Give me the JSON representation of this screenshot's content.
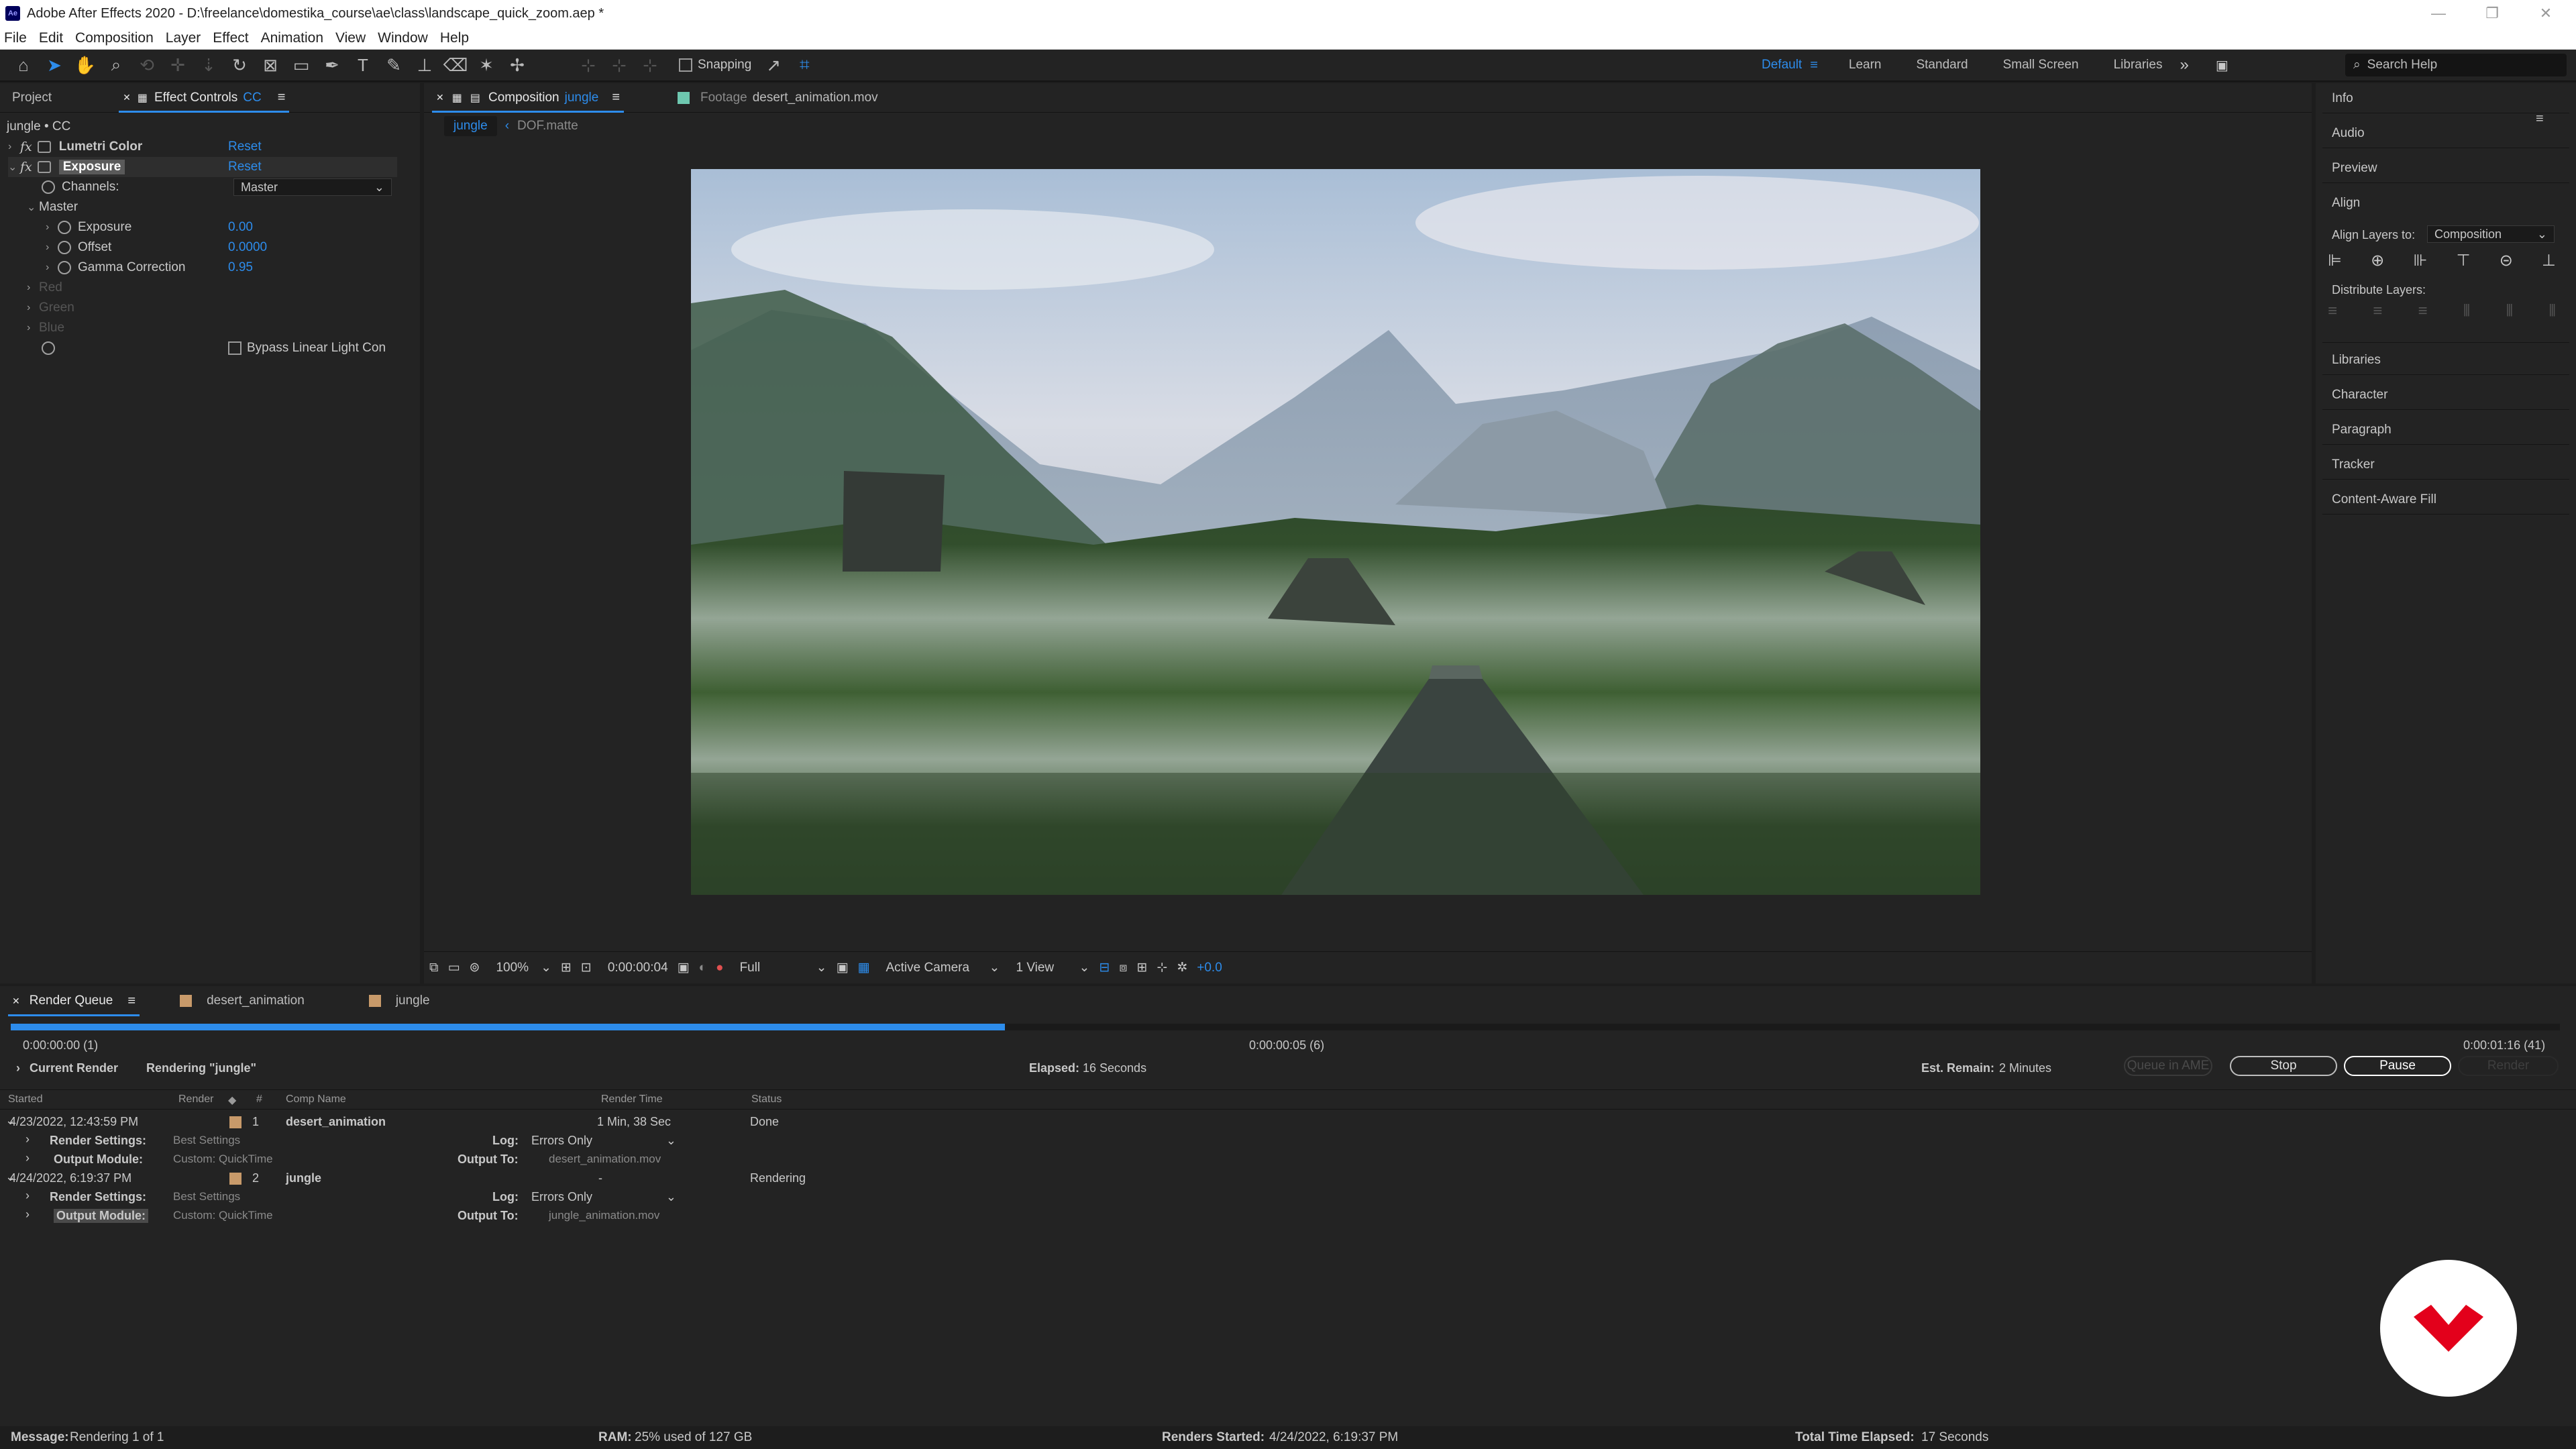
{
  "window": {
    "title": "Adobe After Effects 2020 - D:\\freelance\\domestika_course\\ae\\class\\landscape_quick_zoom.aep *",
    "logo": "Ae"
  },
  "menu": [
    "File",
    "Edit",
    "Composition",
    "Layer",
    "Effect",
    "Animation",
    "View",
    "Window",
    "Help"
  ],
  "toolbar": {
    "snapping_label": "Snapping",
    "workspaces": [
      "Default",
      "Learn",
      "Standard",
      "Small Screen",
      "Libraries"
    ],
    "active_workspace": "Default",
    "search_placeholder": "Search Help"
  },
  "effect_controls": {
    "tabs": [
      "Project",
      "Effect Controls",
      "CC"
    ],
    "layer_title": "jungle • CC",
    "effects": [
      {
        "name": "Lumetri Color",
        "reset": "Reset"
      },
      {
        "name": "Exposure",
        "reset": "Reset"
      }
    ],
    "channels_label": "Channels:",
    "channels_value": "Master",
    "master_label": "Master",
    "params": [
      {
        "name": "Exposure",
        "value": "0.00"
      },
      {
        "name": "Offset",
        "value": "0.0000"
      },
      {
        "name": "Gamma Correction",
        "value": "0.95"
      }
    ],
    "disabled_channels": [
      "Red",
      "Green",
      "Blue"
    ],
    "bypass_label": "Bypass Linear Light Con"
  },
  "composition": {
    "tab_label": "Composition",
    "tab_comp": "jungle",
    "footage_tab": "Footage",
    "footage_name": "desert_animation.mov",
    "breadcrumb": [
      "jungle",
      "DOF.matte"
    ],
    "zoom": "100%",
    "timecode": "0:00:00:04",
    "resolution": "Full",
    "camera": "Active Camera",
    "views": "1 View",
    "exposure_value": "+0.0"
  },
  "right_panel": {
    "items_top": [
      "Info",
      "Audio",
      "Preview"
    ],
    "align_title": "Align",
    "align_layers_label": "Align Layers to:",
    "align_layers_value": "Composition",
    "distribute_label": "Distribute Layers:",
    "items_bottom": [
      "Libraries",
      "Character",
      "Paragraph",
      "Tracker",
      "Content-Aware Fill"
    ]
  },
  "render_queue": {
    "tabs": [
      "Render Queue",
      "desert_animation",
      "jungle"
    ],
    "progress": 0.39,
    "time_start": "0:00:00:00 (1)",
    "time_mid": "0:00:00:05 (6)",
    "time_end": "0:00:01:16 (41)",
    "current_render_label": "Current Render",
    "rendering_text": "Rendering \"jungle\"",
    "elapsed_label": "Elapsed:",
    "elapsed_value": "16 Seconds",
    "remain_label": "Est. Remain:",
    "remain_value": "2 Minutes",
    "buttons": {
      "queue_ame": "Queue in AME",
      "stop": "Stop",
      "pause": "Pause",
      "render": "Render"
    },
    "columns": {
      "started": "Started",
      "render": "Render",
      "num": "#",
      "comp_name": "Comp Name",
      "render_time": "Render Time",
      "status": "Status"
    },
    "items": [
      {
        "started": "4/23/2022, 12:43:59 PM",
        "num": "1",
        "comp": "desert_animation",
        "render_time": "1 Min, 38 Sec",
        "status": "Done",
        "render_settings_label": "Render Settings:",
        "render_settings": "Best Settings",
        "log_label": "Log:",
        "log": "Errors Only",
        "output_module_label": "Output Module:",
        "output_module": "Custom: QuickTime",
        "output_to_label": "Output To:",
        "output_to": "desert_animation.mov"
      },
      {
        "started": "4/24/2022, 6:19:37 PM",
        "num": "2",
        "comp": "jungle",
        "render_time": "-",
        "status": "Rendering",
        "render_settings_label": "Render Settings:",
        "render_settings": "Best Settings",
        "log_label": "Log:",
        "log": "Errors Only",
        "output_module_label": "Output Module:",
        "output_module": "Custom: QuickTime",
        "output_to_label": "Output To:",
        "output_to": "jungle_animation.mov"
      }
    ]
  },
  "status_bar": {
    "message_label": "Message:",
    "message": "Rendering 1 of 1",
    "ram_label": "RAM:",
    "ram": "25% used of 127 GB",
    "renders_started_label": "Renders Started:",
    "renders_started": "4/24/2022, 6:19:37 PM",
    "total_elapsed_label": "Total Time Elapsed:",
    "total_elapsed": "17 Seconds"
  },
  "colors": {
    "accent": "#2d8ceb",
    "panel": "#232323",
    "watermark": "#e3001b"
  }
}
